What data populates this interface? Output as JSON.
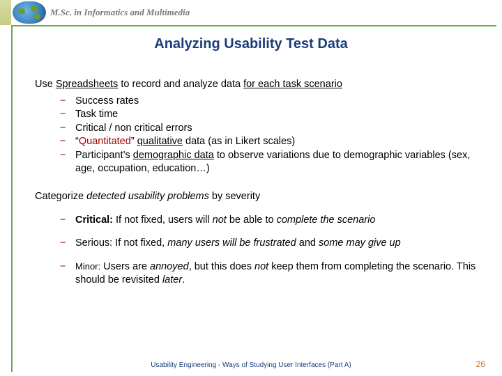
{
  "header": {
    "program": "M.Sc. in Informatics and Multimedia"
  },
  "title": "Analyzing Usability Test Data",
  "p1": {
    "pre": "Use ",
    "spreadsheets": "Spreadsheets",
    "mid": " to record and analyze data ",
    "scenario": "for each task scenario"
  },
  "bullets": {
    "b1": "Success rates",
    "b2": "Task time",
    "b3": "Critical / non critical errors",
    "b4_q1": "“",
    "b4_quant": "Quantitated",
    "b4_q2": "” ",
    "b4_qual": "qualitative",
    "b4_tail": " data (as in Likert scales)",
    "b5_pre": "Participant’s ",
    "b5_demo": "demographic data",
    "b5_tail": "  to observe variations due to demographic variables (sex, age, occupation, education…)"
  },
  "p2": {
    "pre": "Categorize ",
    "mid": "detected usability problems",
    "tail": " by severity"
  },
  "sev": {
    "crit_label": "Critical:",
    "crit_pre": " If not fixed, users will ",
    "crit_neg": "not",
    "crit_mid": " be able to ",
    "crit_done": "complete the scenario",
    "ser_label": "Serious:",
    "ser_pre": " If not fixed, ",
    "ser_many": "many users will be frustrated",
    "ser_mid": " and ",
    "ser_give": "some may give up",
    "min_label": "Minor:",
    "min_pre": "  Users are ",
    "min_ann": "annoyed",
    "min_mid1": ", but this does ",
    "min_neg": "not",
    "min_mid2": " keep them from completing the scenario. This should be revisited ",
    "min_later": "later",
    "min_dot": "."
  },
  "footer": "Usability Engineering  -  Ways of Studying User Interfaces (Part A)",
  "page": "26",
  "dash": "−"
}
